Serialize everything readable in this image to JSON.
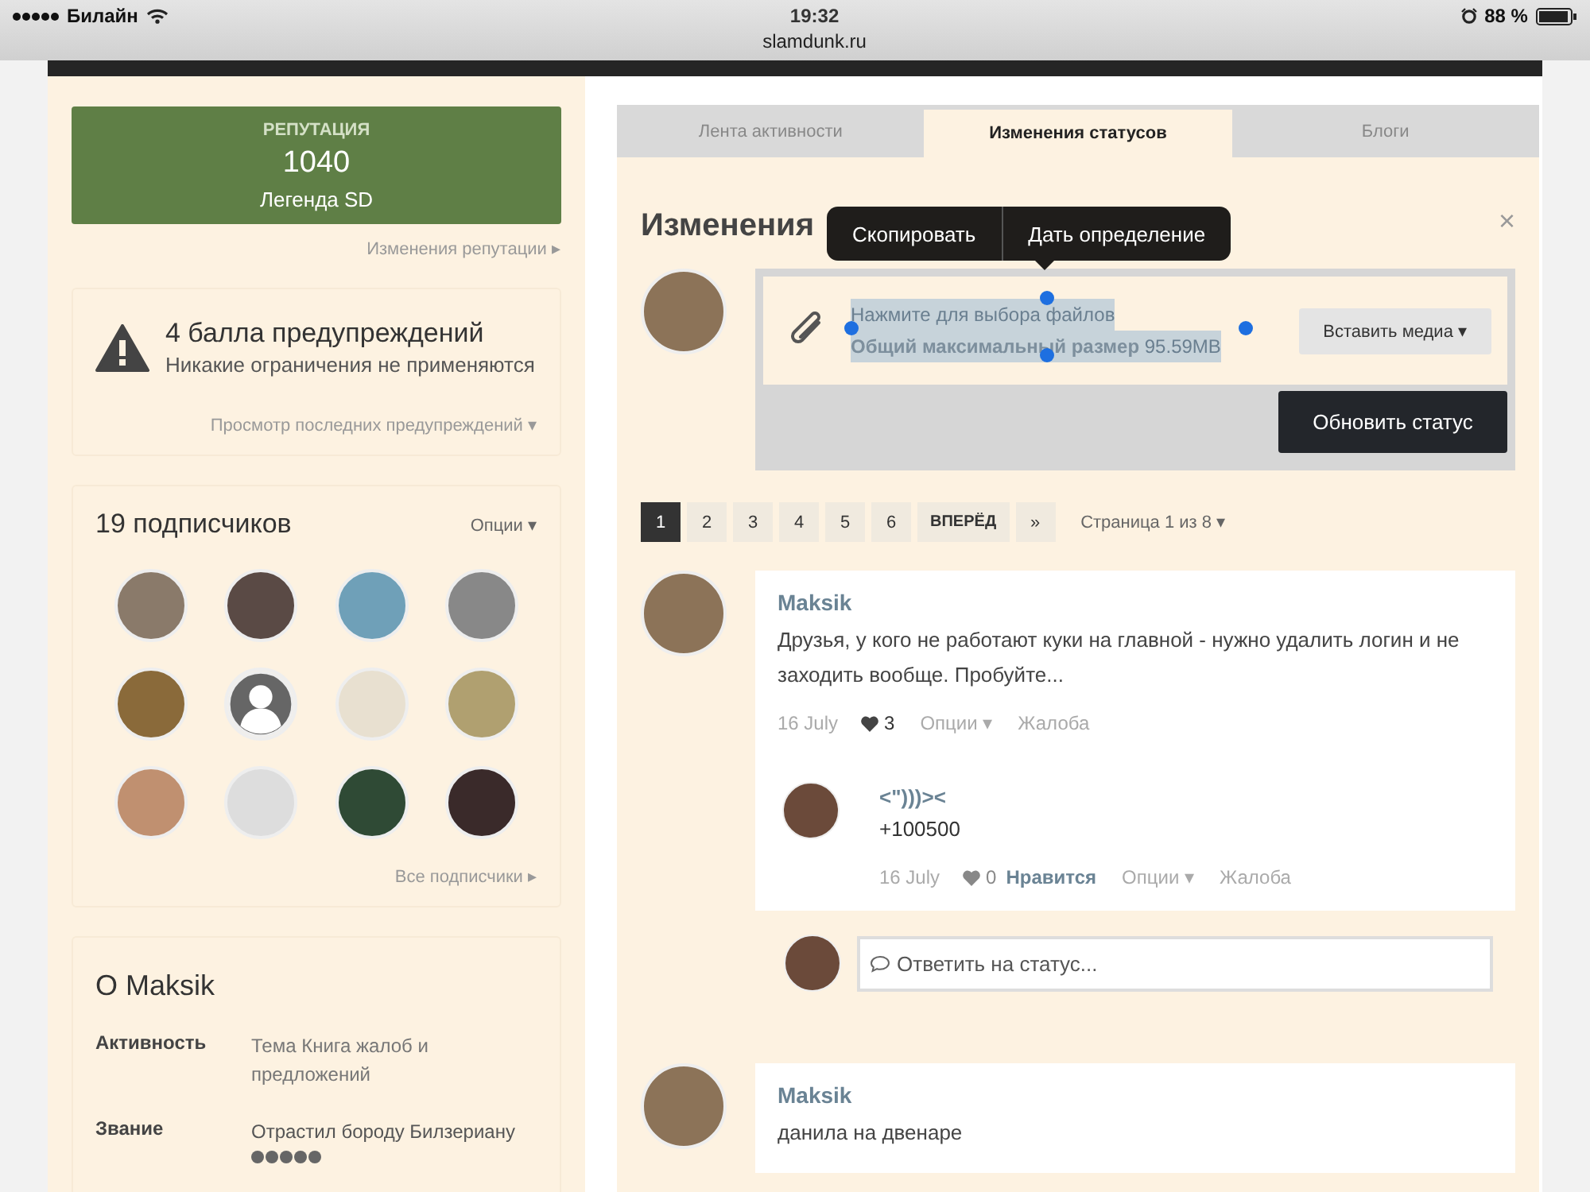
{
  "status_bar": {
    "carrier": "Билайн",
    "time": "19:32",
    "url": "slamdunk.ru",
    "battery": "88 %"
  },
  "reputation": {
    "label": "РЕПУТАЦИЯ",
    "value": "1040",
    "rank": "Легенда SD",
    "link": "Изменения репутации ▸"
  },
  "warnings": {
    "title": "4 балла предупреждений",
    "subtitle": "Никакие ограничения не применяются",
    "link": "Просмотр последних предупреждений ▾"
  },
  "followers": {
    "title": "19 подписчиков",
    "options": "Опции ▾",
    "link": "Все подписчики ▸",
    "avatars": [
      {
        "kind": "photo"
      },
      {
        "kind": "photo"
      },
      {
        "kind": "photo"
      },
      {
        "kind": "photo"
      },
      {
        "kind": "photo"
      },
      {
        "kind": "default"
      },
      {
        "kind": "photo"
      },
      {
        "kind": "photo"
      },
      {
        "kind": "photo"
      },
      {
        "kind": "photo"
      },
      {
        "kind": "photo"
      },
      {
        "kind": "photo"
      }
    ]
  },
  "about": {
    "title": "О Maksik",
    "fields": [
      {
        "label": "Активность",
        "value": "Тема Книга жалоб и предложений"
      },
      {
        "label": "Звание",
        "value": "Отрастил бороду Билзериану",
        "stars": 5
      }
    ]
  },
  "tabs": [
    {
      "label": "Лента активности",
      "selected": false
    },
    {
      "label": "Изменения статусов",
      "selected": true
    },
    {
      "label": "Блоги",
      "selected": false
    }
  ],
  "heading": "Изменения",
  "close": "×",
  "edit_menu": [
    "Скопировать",
    "Дать определение"
  ],
  "composer": {
    "upload_text": "Нажмите для выбора файлов",
    "size_label": "Общий максимальный размер",
    "size_value": "95.59MB",
    "text_selected": true,
    "media_button": "Вставить медиа ▾",
    "submit_button": "Обновить статус"
  },
  "pagination": {
    "pages": [
      {
        "label": "1",
        "selected": true
      },
      {
        "label": "2",
        "selected": false
      },
      {
        "label": "3",
        "selected": false
      },
      {
        "label": "4",
        "selected": false
      },
      {
        "label": "5",
        "selected": false
      },
      {
        "label": "6",
        "selected": false
      }
    ],
    "next": "ВПЕРЁД",
    "last": "»",
    "info": "Страница 1 из 8 ▾"
  },
  "posts": [
    {
      "author": "Maksik",
      "text": "Друзья, у кого не работают куки на главной - нужно удалить логин и не заходить вообще. Пробуйте...",
      "date": "16 July",
      "likes": "3",
      "options": "Опции ▾",
      "report": "Жалоба",
      "replies": [
        {
          "author": "<\")))><",
          "text": "+100500",
          "date": "16 July",
          "likes": "0",
          "like_link": "Нравится",
          "options": "Опции ▾",
          "report": "Жалоба"
        }
      ],
      "reply_placeholder": "Ответить на статус..."
    },
    {
      "author": "Maksik",
      "text": "данила на двенаре"
    }
  ]
}
